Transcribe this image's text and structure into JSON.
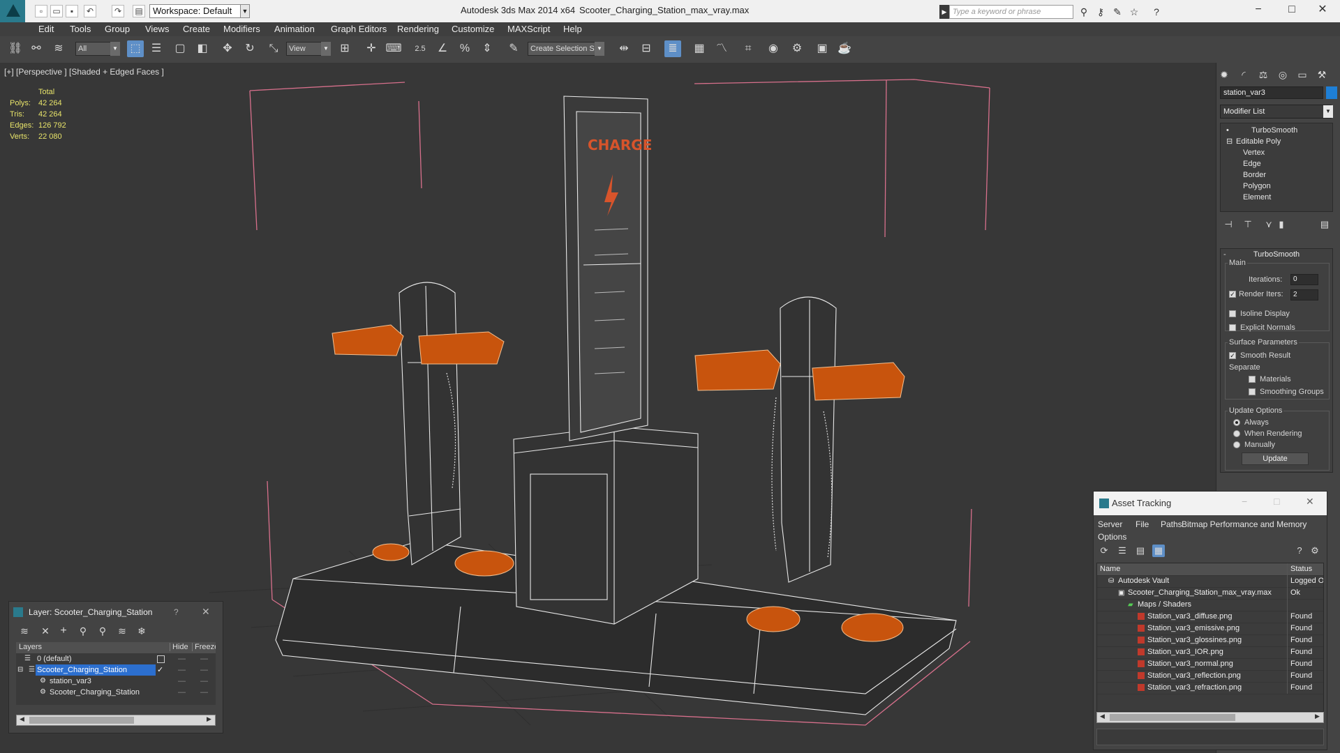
{
  "titlebar": {
    "workspace": "Workspace: Default",
    "app_title": "Autodesk 3ds Max  2014 x64",
    "file_title": "Scooter_Charging_Station_max_vray.max",
    "search_placeholder": "Type a keyword or phrase"
  },
  "menu": [
    "Edit",
    "Tools",
    "Group",
    "Views",
    "Create",
    "Modifiers",
    "Animation",
    "Graph Editors",
    "Rendering",
    "Customize",
    "MAXScript",
    "Help"
  ],
  "toolbar": {
    "filter": "All",
    "ref_coord": "View",
    "snap_value": "2.5",
    "selection_set": "Create Selection Se"
  },
  "viewport": {
    "label": "[+] [Perspective ] [Shaded + Edged Faces ]",
    "stats_header": "Total",
    "stats": [
      {
        "label": "Polys:",
        "value": "42 264"
      },
      {
        "label": "Tris:",
        "value": "42 264"
      },
      {
        "label": "Edges:",
        "value": "126 792"
      },
      {
        "label": "Verts:",
        "value": "22 080"
      }
    ],
    "sign_text": "CHARGE"
  },
  "command_panel": {
    "object_name": "station_var3",
    "object_color": "#1e7fd6",
    "modifier_list": "Modifier List",
    "stack": [
      {
        "label": "TurboSmooth",
        "level": 0
      },
      {
        "label": "Editable Poly",
        "level": 0
      },
      {
        "label": "Vertex",
        "level": 1
      },
      {
        "label": "Edge",
        "level": 1
      },
      {
        "label": "Border",
        "level": 1
      },
      {
        "label": "Polygon",
        "level": 1
      },
      {
        "label": "Element",
        "level": 1
      }
    ],
    "rollout_title": "TurboSmooth",
    "main_group": "Main",
    "iterations_label": "Iterations:",
    "iterations_value": "0",
    "render_iters_label": "Render Iters:",
    "render_iters_value": "2",
    "isoline_label": "Isoline Display",
    "explicit_normals_label": "Explicit Normals",
    "surface_group": "Surface Parameters",
    "smooth_result_label": "Smooth Result",
    "separate_label": "Separate",
    "materials_label": "Materials",
    "smoothing_groups_label": "Smoothing Groups",
    "update_group": "Update Options",
    "always_label": "Always",
    "when_rendering_label": "When Rendering",
    "manually_label": "Manually",
    "update_button": "Update"
  },
  "layer_dialog": {
    "title": "Layer: Scooter_Charging_Station",
    "help": "?",
    "columns": [
      "Layers",
      "Hide",
      "Freeze"
    ],
    "rows": [
      {
        "name": "0 (default)"
      },
      {
        "name": "Scooter_Charging_Station"
      },
      {
        "name": "station_var3"
      },
      {
        "name": "Scooter_Charging_Station"
      }
    ]
  },
  "asset_dialog": {
    "title": "Asset Tracking",
    "menu": [
      "Server",
      "File",
      "Paths",
      "Bitmap Performance and Memory",
      "Options"
    ],
    "columns": [
      "Name",
      "Status"
    ],
    "rows": [
      {
        "name": "Autodesk Vault",
        "status": "Logged O"
      },
      {
        "name": "Scooter_Charging_Station_max_vray.max",
        "status": "Ok"
      },
      {
        "name": "Maps / Shaders",
        "status": ""
      },
      {
        "name": "Station_var3_diffuse.png",
        "status": "Found"
      },
      {
        "name": "Station_var3_emissive.png",
        "status": "Found"
      },
      {
        "name": "Station_var3_glossines.png",
        "status": "Found"
      },
      {
        "name": "Station_var3_IOR.png",
        "status": "Found"
      },
      {
        "name": "Station_var3_normal.png",
        "status": "Found"
      },
      {
        "name": "Station_var3_reflection.png",
        "status": "Found"
      },
      {
        "name": "Station_var3_refraction.png",
        "status": "Found"
      }
    ]
  }
}
